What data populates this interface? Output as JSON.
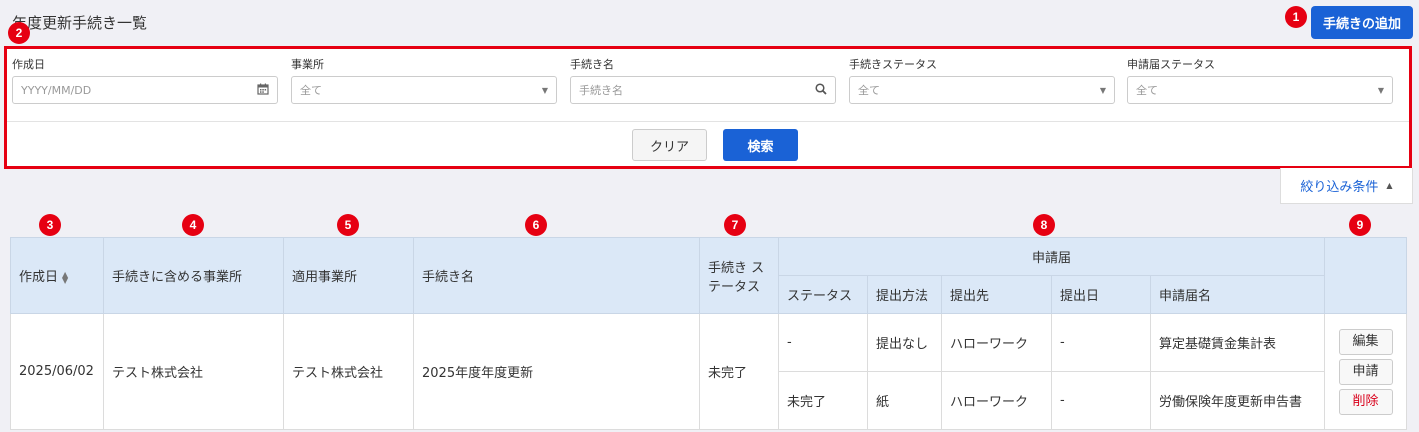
{
  "page": {
    "title": "年度更新手続き一覧"
  },
  "header": {
    "add_button": "手続きの追加"
  },
  "markers": [
    "1",
    "2",
    "3",
    "4",
    "5",
    "6",
    "7",
    "8",
    "9"
  ],
  "filters": {
    "created_label": "作成日",
    "created_placeholder": "YYYY/MM/DD",
    "office_label": "事業所",
    "office_value": "全て",
    "procname_label": "手続き名",
    "procname_placeholder": "手続き名",
    "procstatus_label": "手続きステータス",
    "procstatus_value": "全て",
    "appstatus_label": "申請届ステータス",
    "appstatus_value": "全て",
    "clear_button": "クリア",
    "search_button": "検索"
  },
  "filter_toggle": {
    "label": "絞り込み条件"
  },
  "table": {
    "headers": {
      "created": "作成日",
      "included_offices": "手続きに含める事業所",
      "applied_office": "適用事業所",
      "procedure_name": "手続き名",
      "procedure_status": "手続き ステータス",
      "application_group": "申請届",
      "app_status": "ステータス",
      "submit_method": "提出方法",
      "submit_to": "提出先",
      "submit_date": "提出日",
      "app_name": "申請届名"
    },
    "row": {
      "created": "2025/06/02",
      "included_offices": "テスト株式会社",
      "applied_office": "テスト株式会社",
      "procedure_name": "2025年度年度更新",
      "procedure_status": "未完了",
      "applications": [
        {
          "status": "-",
          "method": "提出なし",
          "to": "ハローワーク",
          "date": "-",
          "name": "算定基礎賃金集計表"
        },
        {
          "status": "未完了",
          "method": "紙",
          "to": "ハローワーク",
          "date": "-",
          "name": "労働保険年度更新申告書"
        }
      ],
      "actions": {
        "edit": "編集",
        "apply": "申請",
        "delete": "削除"
      }
    }
  },
  "colors": {
    "accent": "#1a62d6",
    "marker": "#e60012",
    "danger": "#d9001b",
    "header_bg": "#dbe8f7"
  }
}
